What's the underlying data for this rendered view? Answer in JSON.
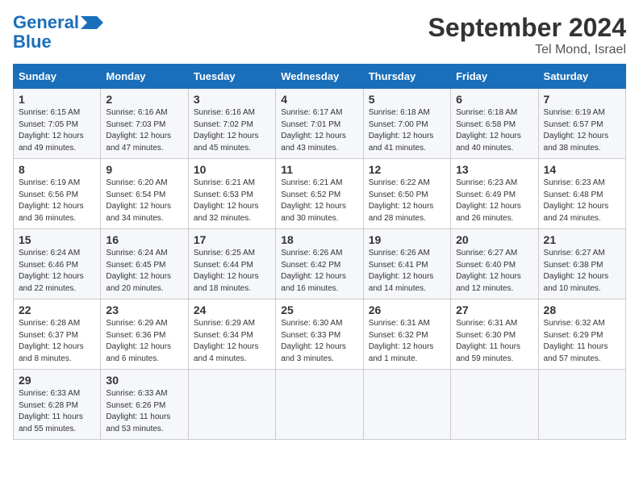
{
  "header": {
    "logo_line1": "General",
    "logo_line2": "Blue",
    "title": "September 2024",
    "subtitle": "Tel Mond, Israel"
  },
  "weekdays": [
    "Sunday",
    "Monday",
    "Tuesday",
    "Wednesday",
    "Thursday",
    "Friday",
    "Saturday"
  ],
  "weeks": [
    [
      {
        "day": "1",
        "info": "Sunrise: 6:15 AM\nSunset: 7:05 PM\nDaylight: 12 hours\nand 49 minutes."
      },
      {
        "day": "2",
        "info": "Sunrise: 6:16 AM\nSunset: 7:03 PM\nDaylight: 12 hours\nand 47 minutes."
      },
      {
        "day": "3",
        "info": "Sunrise: 6:16 AM\nSunset: 7:02 PM\nDaylight: 12 hours\nand 45 minutes."
      },
      {
        "day": "4",
        "info": "Sunrise: 6:17 AM\nSunset: 7:01 PM\nDaylight: 12 hours\nand 43 minutes."
      },
      {
        "day": "5",
        "info": "Sunrise: 6:18 AM\nSunset: 7:00 PM\nDaylight: 12 hours\nand 41 minutes."
      },
      {
        "day": "6",
        "info": "Sunrise: 6:18 AM\nSunset: 6:58 PM\nDaylight: 12 hours\nand 40 minutes."
      },
      {
        "day": "7",
        "info": "Sunrise: 6:19 AM\nSunset: 6:57 PM\nDaylight: 12 hours\nand 38 minutes."
      }
    ],
    [
      {
        "day": "8",
        "info": "Sunrise: 6:19 AM\nSunset: 6:56 PM\nDaylight: 12 hours\nand 36 minutes."
      },
      {
        "day": "9",
        "info": "Sunrise: 6:20 AM\nSunset: 6:54 PM\nDaylight: 12 hours\nand 34 minutes."
      },
      {
        "day": "10",
        "info": "Sunrise: 6:21 AM\nSunset: 6:53 PM\nDaylight: 12 hours\nand 32 minutes."
      },
      {
        "day": "11",
        "info": "Sunrise: 6:21 AM\nSunset: 6:52 PM\nDaylight: 12 hours\nand 30 minutes."
      },
      {
        "day": "12",
        "info": "Sunrise: 6:22 AM\nSunset: 6:50 PM\nDaylight: 12 hours\nand 28 minutes."
      },
      {
        "day": "13",
        "info": "Sunrise: 6:23 AM\nSunset: 6:49 PM\nDaylight: 12 hours\nand 26 minutes."
      },
      {
        "day": "14",
        "info": "Sunrise: 6:23 AM\nSunset: 6:48 PM\nDaylight: 12 hours\nand 24 minutes."
      }
    ],
    [
      {
        "day": "15",
        "info": "Sunrise: 6:24 AM\nSunset: 6:46 PM\nDaylight: 12 hours\nand 22 minutes."
      },
      {
        "day": "16",
        "info": "Sunrise: 6:24 AM\nSunset: 6:45 PM\nDaylight: 12 hours\nand 20 minutes."
      },
      {
        "day": "17",
        "info": "Sunrise: 6:25 AM\nSunset: 6:44 PM\nDaylight: 12 hours\nand 18 minutes."
      },
      {
        "day": "18",
        "info": "Sunrise: 6:26 AM\nSunset: 6:42 PM\nDaylight: 12 hours\nand 16 minutes."
      },
      {
        "day": "19",
        "info": "Sunrise: 6:26 AM\nSunset: 6:41 PM\nDaylight: 12 hours\nand 14 minutes."
      },
      {
        "day": "20",
        "info": "Sunrise: 6:27 AM\nSunset: 6:40 PM\nDaylight: 12 hours\nand 12 minutes."
      },
      {
        "day": "21",
        "info": "Sunrise: 6:27 AM\nSunset: 6:38 PM\nDaylight: 12 hours\nand 10 minutes."
      }
    ],
    [
      {
        "day": "22",
        "info": "Sunrise: 6:28 AM\nSunset: 6:37 PM\nDaylight: 12 hours\nand 8 minutes."
      },
      {
        "day": "23",
        "info": "Sunrise: 6:29 AM\nSunset: 6:36 PM\nDaylight: 12 hours\nand 6 minutes."
      },
      {
        "day": "24",
        "info": "Sunrise: 6:29 AM\nSunset: 6:34 PM\nDaylight: 12 hours\nand 4 minutes."
      },
      {
        "day": "25",
        "info": "Sunrise: 6:30 AM\nSunset: 6:33 PM\nDaylight: 12 hours\nand 3 minutes."
      },
      {
        "day": "26",
        "info": "Sunrise: 6:31 AM\nSunset: 6:32 PM\nDaylight: 12 hours\nand 1 minute."
      },
      {
        "day": "27",
        "info": "Sunrise: 6:31 AM\nSunset: 6:30 PM\nDaylight: 11 hours\nand 59 minutes."
      },
      {
        "day": "28",
        "info": "Sunrise: 6:32 AM\nSunset: 6:29 PM\nDaylight: 11 hours\nand 57 minutes."
      }
    ],
    [
      {
        "day": "29",
        "info": "Sunrise: 6:33 AM\nSunset: 6:28 PM\nDaylight: 11 hours\nand 55 minutes."
      },
      {
        "day": "30",
        "info": "Sunrise: 6:33 AM\nSunset: 6:26 PM\nDaylight: 11 hours\nand 53 minutes."
      },
      {
        "day": "",
        "info": ""
      },
      {
        "day": "",
        "info": ""
      },
      {
        "day": "",
        "info": ""
      },
      {
        "day": "",
        "info": ""
      },
      {
        "day": "",
        "info": ""
      }
    ]
  ]
}
